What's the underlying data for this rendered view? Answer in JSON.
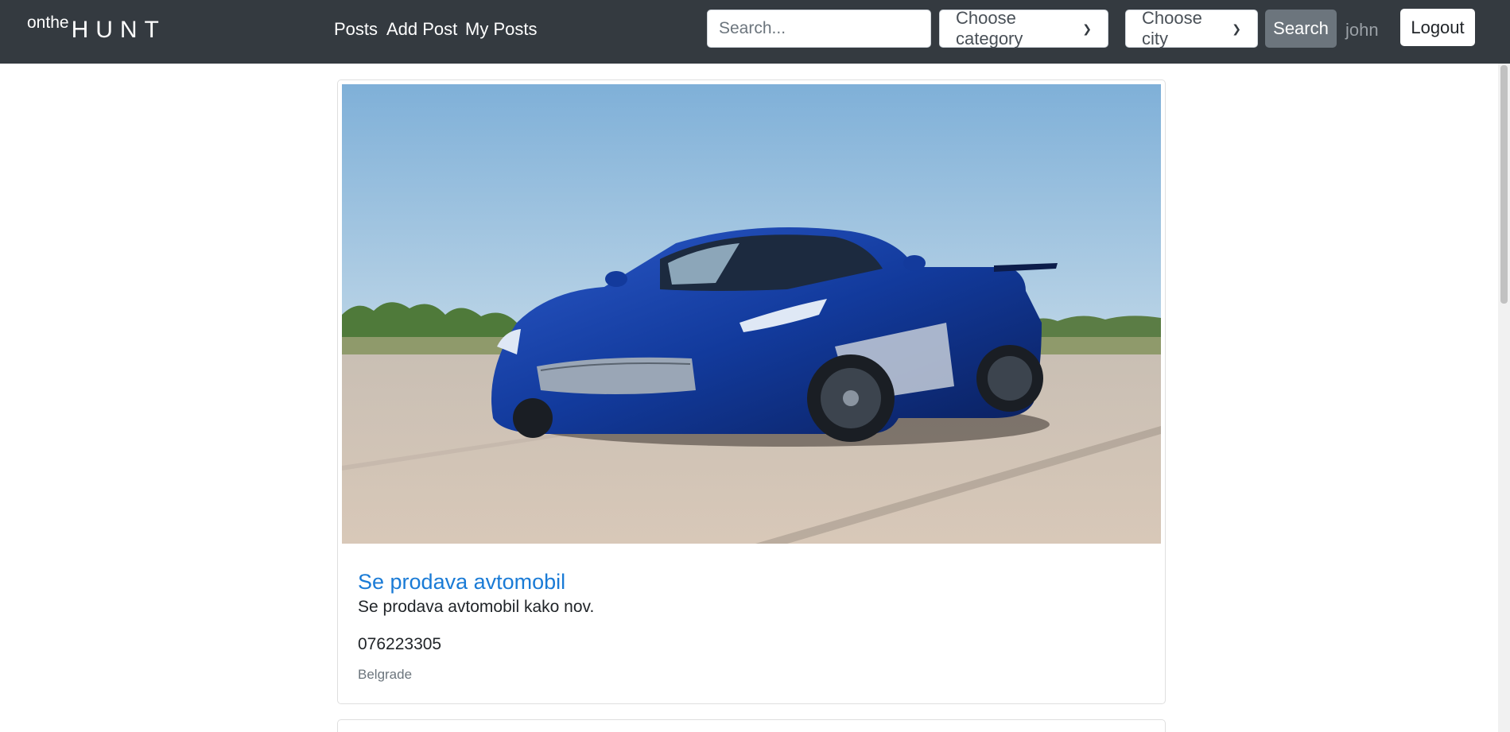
{
  "brand": {
    "small": "onthe",
    "big": "HUNT"
  },
  "nav": {
    "posts": "Posts",
    "add_post": "Add Post",
    "my_posts": "My Posts"
  },
  "search": {
    "placeholder": "Search...",
    "category_placeholder": "Choose category",
    "city_placeholder": "Choose city",
    "button": "Search"
  },
  "user": {
    "name": "john",
    "logout": "Logout"
  },
  "post": {
    "title": "Se prodava avtomobil",
    "description": "Se prodava avtomobil kako nov.",
    "phone": "076223305",
    "city": "Belgrade"
  },
  "colors": {
    "navbar": "#343a40",
    "link": "#1a7bd6",
    "muted": "#6c757d"
  }
}
